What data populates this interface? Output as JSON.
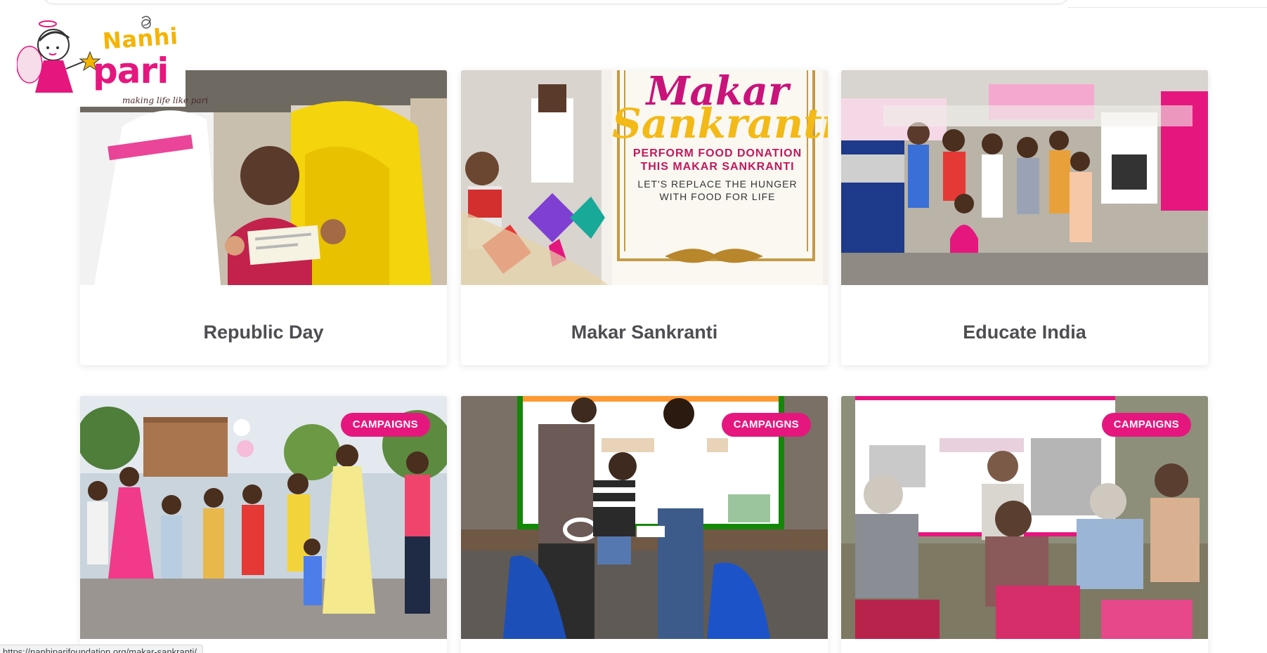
{
  "header": {
    "logo_line1": "Nanhi",
    "logo_line2": "pari",
    "logo_tagline": "making life like pari"
  },
  "cards_row1": [
    {
      "title": "Republic Day"
    },
    {
      "title": "Makar Sankranti"
    },
    {
      "title": "Educate India"
    }
  ],
  "makar_sankranti_banner": {
    "script_line1": "Makar",
    "script_line2": "Sankranti",
    "line1": "PERFORM FOOD DONATION",
    "line2": "THIS MAKAR SANKRANTI",
    "line3": "LET'S REPLACE THE HUNGER",
    "line4": "WITH FOOD FOR LIFE"
  },
  "cards_row2": [
    {
      "badge": "CAMPAIGNS"
    },
    {
      "badge": "CAMPAIGNS"
    },
    {
      "badge": "CAMPAIGNS"
    }
  ],
  "status_bar": {
    "url": "https://nanhiparifoundation.org/makar-sankranti/"
  },
  "colors": {
    "brand_pink": "#e5177e",
    "brand_yellow": "#f5b400",
    "title_gray": "#4e4e52"
  }
}
